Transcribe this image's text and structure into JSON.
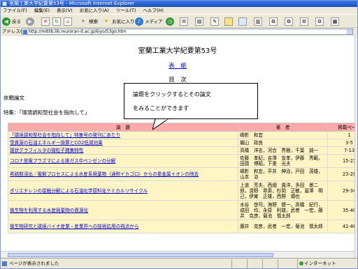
{
  "window": {
    "title": "室蘭工業大学紀要第53号 - Microsoft Internet Explorer"
  },
  "menu": [
    "ファイル(F)",
    "編集(E)",
    "表示(V)",
    "お気に入り(A)",
    "ツール(T)",
    "ヘルプ(H)"
  ],
  "toolbar": {
    "back": "戻る",
    "search": "検索",
    "favorites": "お気に入り",
    "media": "メディア"
  },
  "address": {
    "label": "アドレス(D)",
    "value": "http://mitlib.lib.muroran-it.ac.jp/kiyo/53go.htm"
  },
  "page": {
    "title": "室蘭工業大学紀要第53号",
    "cover_link": "表　紙",
    "toc_title": "目　次",
    "category": "依頼論文",
    "feature": "特集：「環境調和型社会を指向して」"
  },
  "callout": {
    "line1": "論題をクリックするとその論文",
    "line2": "をみることができます"
  },
  "table": {
    "headers": [
      "論　題",
      "著　者",
      "掲載ページ"
    ],
    "rows": [
      {
        "title": "「環境調和型社会を指向して」特集号の発刊にあたり",
        "authors": "嶋影　和宜",
        "pages": "1"
      },
      {
        "title": "雪資源の石油エネルギー換算とCO2低減効果",
        "authors": "媚山　政良",
        "pages": "3-5"
      },
      {
        "title": "環状グラフィルタの微粒子捕集特性",
        "authors": "高橋　洋志，河合　秀樹，千葉　誠一",
        "pages": "7-13"
      },
      {
        "title": "コロナ放電プラズマによる排ガス中ベンゼンの分解",
        "authors": "佐藤　孝紀，吉澤　宣孝，伊藤　秀範，田頭　博昭，下妻　光夫",
        "pages": "15-21"
      },
      {
        "title": "希硫酸浸出／電解プロセスによる水産系廃棄物（通称イカゴロ）からの重金属イオンの除去",
        "authors": "嶋影　和宜，平井　伸治，戸田　茂雄，山本　治",
        "pages": "23-28"
      },
      {
        "title": "ポリエチレンの接触分解による石油化学原料化ケミカルリサイクル",
        "authors": "上道　芳夫，西畑　貴洋，多田　景二郎，清野　章男，杉岡　正敏，冨澤　明己，伊東　正雄，西野　順也",
        "pages": "29-34"
      },
      {
        "title": "微生物を利用する水産廃棄物の資源化",
        "authors": "水谷　啓司，海野　健一，高橋　紀行，成田　均，永原　利雄，武者　一宏，藤井　克彦，菊池　慎太郎",
        "pages": "35-40"
      },
      {
        "title": "微生物研究と環境バイオ産業・産業界への技術応用の視点から",
        "authors": "藤井　克彦，武者　一宏，菊池　慎太郎",
        "pages": "41-46"
      }
    ]
  },
  "status": {
    "message": "ページが表示されました",
    "zone": "インターネット"
  }
}
